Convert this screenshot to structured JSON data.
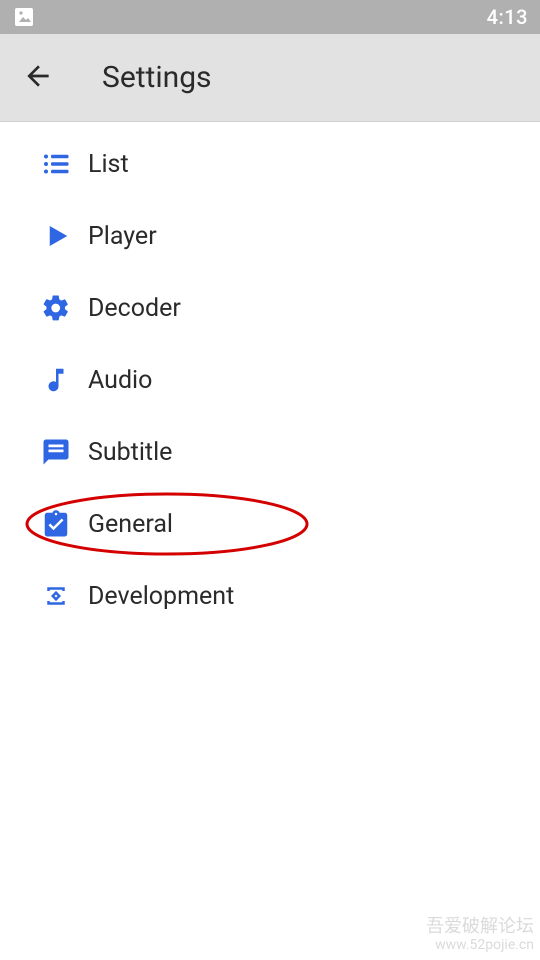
{
  "status_bar": {
    "time": "4:13"
  },
  "app_bar": {
    "title": "Settings"
  },
  "settings_items": [
    {
      "id": "list",
      "label": "List"
    },
    {
      "id": "player",
      "label": "Player"
    },
    {
      "id": "decoder",
      "label": "Decoder"
    },
    {
      "id": "audio",
      "label": "Audio"
    },
    {
      "id": "subtitle",
      "label": "Subtitle"
    },
    {
      "id": "general",
      "label": "General"
    },
    {
      "id": "development",
      "label": "Development"
    }
  ],
  "highlight": {
    "target": "general"
  },
  "watermark": {
    "line1": "吾爱破解论坛",
    "line2": "www.52pojie.cn"
  }
}
